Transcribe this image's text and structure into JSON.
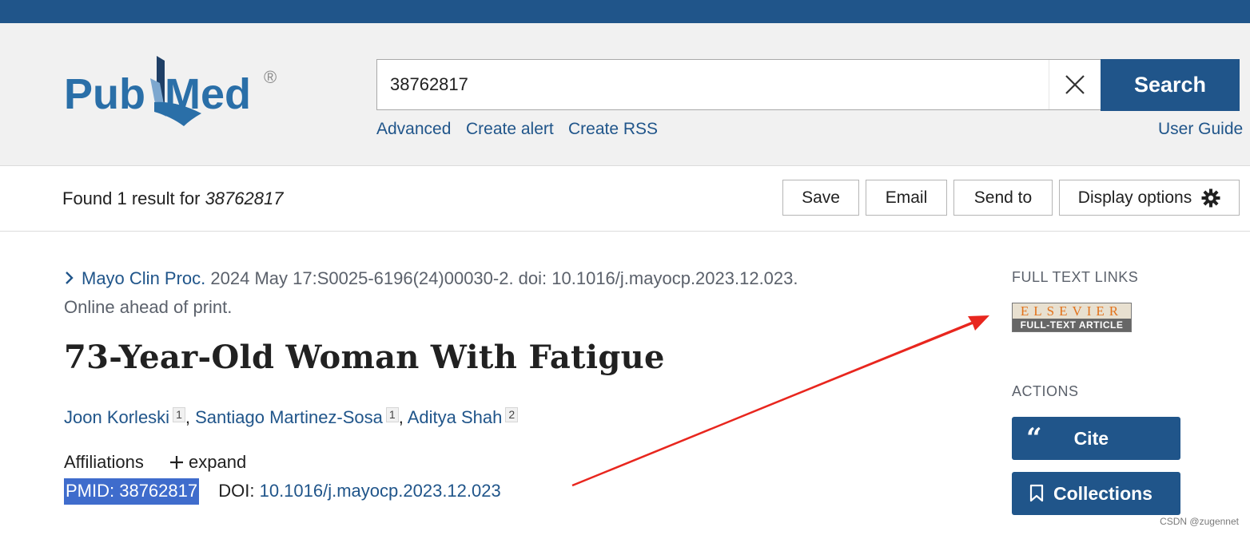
{
  "header": {
    "logo_text": "PubMed",
    "search_value": "38762817",
    "search_button": "Search",
    "links": [
      "Advanced",
      "Create alert",
      "Create RSS"
    ],
    "user_guide": "User Guide"
  },
  "results": {
    "found_prefix": "Found 1 result for",
    "query": "38762817",
    "buttons": [
      "Save",
      "Email",
      "Send to",
      "Display options"
    ]
  },
  "article": {
    "journal": "Mayo Clin Proc.",
    "citation": "2024 May 17:S0025-6196(24)00030-2. doi: 10.1016/j.mayocp.2023.12.023.",
    "status": "Online ahead of print.",
    "title": "73-Year-Old Woman With Fatigue",
    "authors": [
      {
        "name": "Joon Korleski",
        "aff": "1"
      },
      {
        "name": "Santiago Martinez-Sosa",
        "aff": "1"
      },
      {
        "name": "Aditya Shah",
        "aff": "2"
      }
    ],
    "affiliations_label": "Affiliations",
    "expand_label": "expand",
    "pmid": "PMID: 38762817",
    "doi_label": "DOI:",
    "doi": "10.1016/j.mayocp.2023.12.023"
  },
  "sidebar": {
    "full_text_heading": "FULL TEXT LINKS",
    "elsevier_top": "ELSEVIER",
    "elsevier_bottom": "FULL-TEXT ARTICLE",
    "actions_heading": "ACTIONS",
    "cite_label": "Cite",
    "collections_label": "Collections"
  },
  "watermark": "CSDN @zugennet",
  "colors": {
    "brand": "#20558a",
    "header_bg": "#f1f1f1",
    "pmid_highlight": "#3f6ccc",
    "annotation_arrow": "#e8261e"
  }
}
